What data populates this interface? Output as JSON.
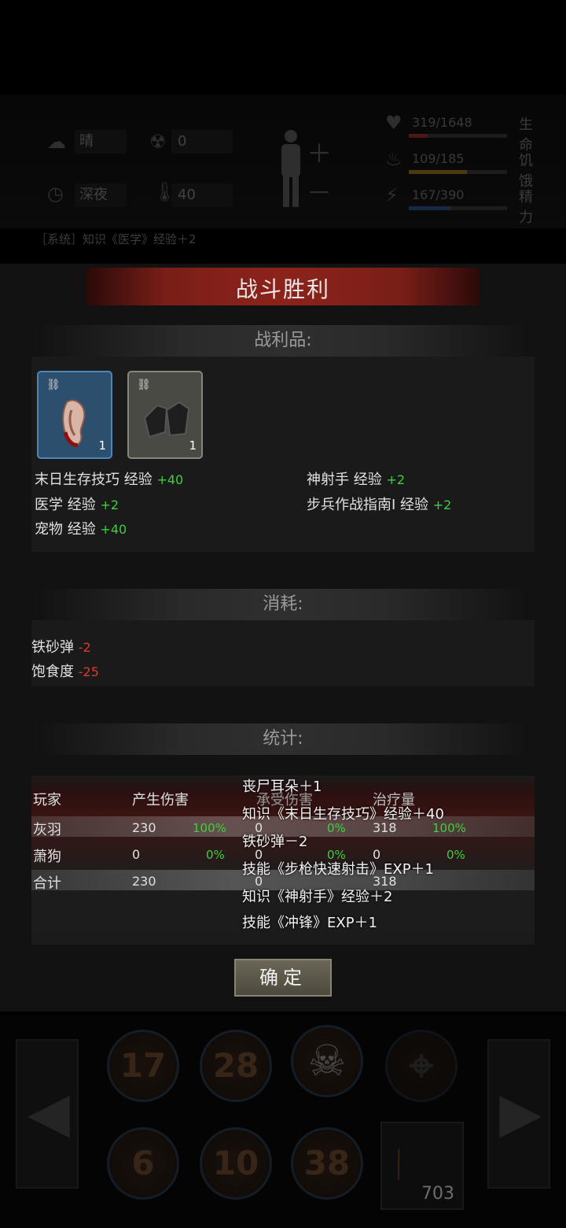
{
  "hud": {
    "weather": "晴",
    "radiation": "0",
    "time_of_day": "深夜",
    "temperature": "40",
    "bars": [
      {
        "text": "319/1648",
        "name": "生命",
        "fill": 0.19,
        "color": "#8a2a2a"
      },
      {
        "text": "109/185",
        "name": "饥饿",
        "fill": 0.59,
        "color": "#8a6a1a"
      },
      {
        "text": "167/390",
        "name": "精力",
        "fill": 0.43,
        "color": "#2a4a7a"
      }
    ],
    "system_log": "［系统］知识《医学》经验＋2"
  },
  "dialog": {
    "title": "战斗胜利",
    "loot_header": "战利品:",
    "items": [
      {
        "icon": "ear-icon",
        "count": "1",
        "bg": "#2d4f6e"
      },
      {
        "icon": "shoes-icon",
        "count": "1",
        "bg": "#4a4a44"
      }
    ],
    "rewards": [
      {
        "label": "末日生存技巧 经验",
        "value": "+40"
      },
      {
        "label": "神射手 经验",
        "value": "+2"
      },
      {
        "label": "医学 经验",
        "value": "+2"
      },
      {
        "label": "步兵作战指南Ⅰ 经验",
        "value": "+2"
      },
      {
        "label": "宠物 经验",
        "value": "+40"
      }
    ],
    "consume_header": "消耗:",
    "consumption": [
      {
        "label": "铁砂弹",
        "value": "-2"
      },
      {
        "label": "饱食度",
        "value": "-25"
      }
    ],
    "stats_header": "统计:",
    "stats_columns": [
      "玩家",
      "产生伤害",
      "承受伤害",
      "治疗量"
    ],
    "stats_rows": [
      {
        "name": "灰羽",
        "dmg": "230",
        "dmg_pct": "100%",
        "taken": "0",
        "taken_pct": "0%",
        "heal": "318",
        "heal_pct": "100%"
      },
      {
        "name": "萧狗",
        "dmg": "0",
        "dmg_pct": "0%",
        "taken": "0",
        "taken_pct": "0%",
        "heal": "0",
        "heal_pct": "0%"
      },
      {
        "name": "合计",
        "dmg": "230",
        "taken": "0",
        "heal": "318"
      }
    ],
    "overlay_messages": [
      "丧尸耳朵＋1",
      "知识《末日生存技巧》经验＋40",
      "铁砂弹－2",
      "技能《步枪快速射击》EXP＋1",
      "知识《神射手》经验＋2",
      "技能《冲锋》EXP＋1"
    ],
    "ok_label": "确定"
  },
  "skillbar": {
    "row1": [
      "17",
      "28",
      "skull-crossbones-icon",
      "crosshair-icon"
    ],
    "row2": [
      "6",
      "10",
      "38"
    ],
    "weapon_ammo": "703"
  }
}
